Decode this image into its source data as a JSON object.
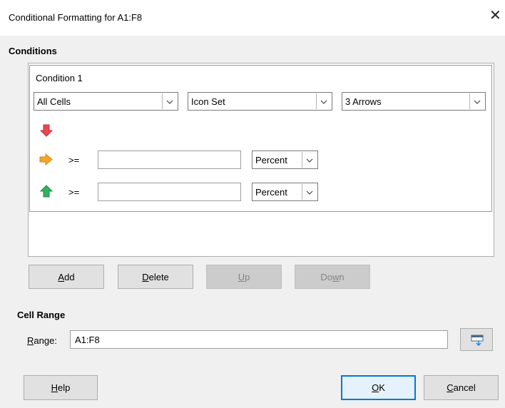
{
  "dialog": {
    "title": "Conditional Formatting for A1:F8",
    "close_glyph": "✕"
  },
  "conditions": {
    "section_label": "Conditions",
    "condition_label": "Condition 1",
    "applies_to": "All Cells",
    "format_type": "Icon Set",
    "icon_set": "3 Arrows",
    "rules": [
      {
        "icon": "arrow-down-icon",
        "color": "#e8454f"
      },
      {
        "icon": "arrow-right-icon",
        "color": "#f5a623",
        "operator": ">=",
        "value": "",
        "unit": "Percent"
      },
      {
        "icon": "arrow-up-icon",
        "color": "#33b060",
        "operator": ">=",
        "value": "",
        "unit": "Percent"
      }
    ]
  },
  "buttons": {
    "add": {
      "mnemonic": "A",
      "rest": "dd"
    },
    "delete": {
      "mnemonic": "D",
      "rest": "elete"
    },
    "up": {
      "mnemonic": "U",
      "rest": "p",
      "enabled": false
    },
    "down": {
      "prefix": "Do",
      "mnemonic": "w",
      "rest": "n",
      "enabled": false
    }
  },
  "cell_range": {
    "section_label": "Cell Range",
    "range_label_mnemonic": "R",
    "range_label_rest": "ange:",
    "range_value": "A1:F8",
    "shrink_button_icon": "shrink-collapse-icon"
  },
  "footer": {
    "help": {
      "mnemonic": "H",
      "rest": "elp"
    },
    "ok": {
      "mnemonic": "O",
      "rest": "K"
    },
    "cancel": {
      "mnemonic": "C",
      "rest": "ancel"
    }
  },
  "colors": {
    "accent": "#0078d7",
    "dialog_bg": "#f0f0f0"
  }
}
